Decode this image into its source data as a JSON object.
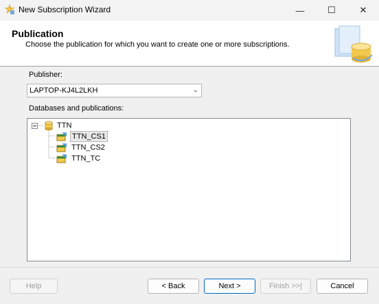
{
  "window": {
    "title": "New Subscription Wizard",
    "minimize_glyph": "—",
    "maximize_glyph": "☐",
    "close_glyph": "✕"
  },
  "header": {
    "title": "Publication",
    "description": "Choose the publication for which you want to create one or more subscriptions."
  },
  "publisher": {
    "label": "Publisher:",
    "value": "LAPTOP-KJ4L2LKH"
  },
  "databases": {
    "label": "Databases and publications:",
    "tree": {
      "root": "TTN",
      "children": [
        "TTN_CS1",
        "TTN_CS2",
        "TTN_TC"
      ],
      "selected": "TTN_CS1"
    }
  },
  "buttons": {
    "help": "Help",
    "back": "< Back",
    "next": "Next >",
    "finish": "Finish >>|",
    "cancel": "Cancel"
  },
  "colors": {
    "accent": "#0067c0",
    "db_yellow": "#f2c94c"
  }
}
